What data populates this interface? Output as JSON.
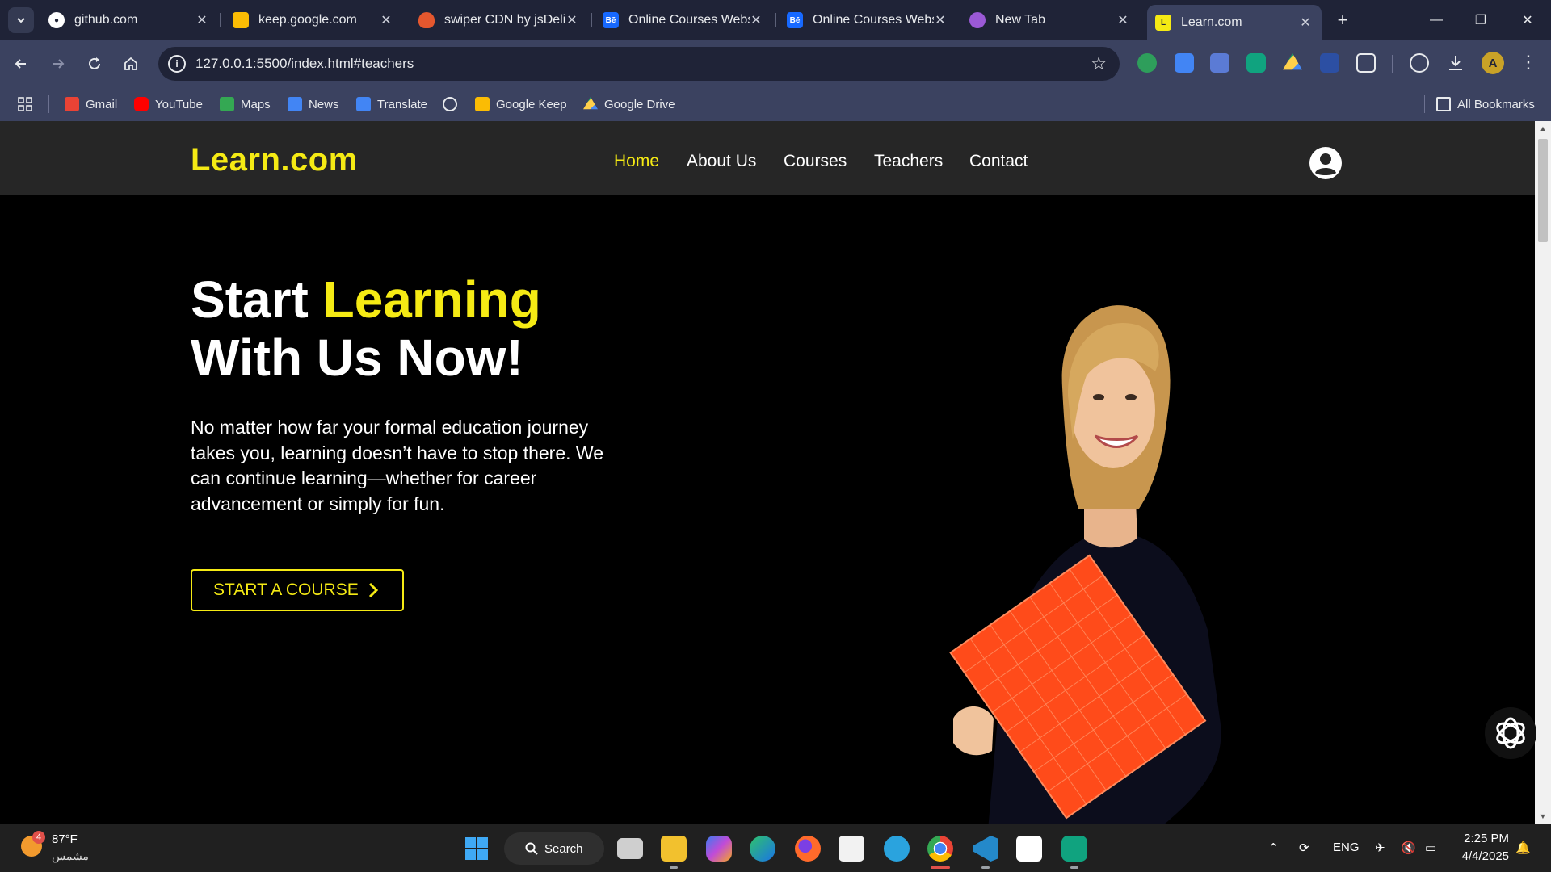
{
  "browser": {
    "tabs": [
      {
        "title": "github.com",
        "favicon": "github-icon"
      },
      {
        "title": "keep.google.com",
        "favicon": "google-keep-icon"
      },
      {
        "title": "swiper CDN by jsDelivr",
        "favicon": "jsdelivr-icon"
      },
      {
        "title": "Online Courses Website",
        "favicon": "behance-icon"
      },
      {
        "title": "Online Courses Website",
        "favicon": "behance-icon"
      },
      {
        "title": "New Tab",
        "favicon": "new-tab-icon"
      },
      {
        "title": "Learn.com",
        "favicon": "learn-com-icon"
      }
    ],
    "url": "127.0.0.1:5500/index.html#teachers",
    "bookmarks": [
      {
        "label": "Gmail",
        "color": "#ea4335"
      },
      {
        "label": "YouTube",
        "color": "#ff0000"
      },
      {
        "label": "Maps",
        "color": "#34a853"
      },
      {
        "label": "News",
        "color": "#4285f4"
      },
      {
        "label": "Translate",
        "color": "#4285f4"
      },
      {
        "label": "Google Keep",
        "color": "#fbbc04"
      },
      {
        "label": "Google Drive",
        "color": "#1fa463"
      }
    ],
    "all_bookmarks": "All Bookmarks"
  },
  "site": {
    "logo": "Learn.com",
    "nav": [
      {
        "label": "Home",
        "active": true
      },
      {
        "label": "About Us",
        "active": false
      },
      {
        "label": "Courses",
        "active": false
      },
      {
        "label": "Teachers",
        "active": false
      },
      {
        "label": "Contact",
        "active": false
      }
    ],
    "hero": {
      "title_part1": "Start ",
      "title_highlight": "Learning",
      "title_line2": "With Us Now!",
      "text": "No matter how far your formal education journey takes you, learning doesn’t have to stop there. We can continue learning—whether for career advancement or simply for fun.",
      "cta": "START A COURSE"
    },
    "colors": {
      "accent": "#f5ea14",
      "header_bg": "#262626",
      "page_bg": "#000000"
    }
  },
  "taskbar": {
    "weather_temp": "87°F",
    "weather_desc": "مشمس",
    "weather_badge": "4",
    "search": "Search",
    "lang": "ENG",
    "time": "2:25 PM",
    "date": "4/4/2025"
  }
}
